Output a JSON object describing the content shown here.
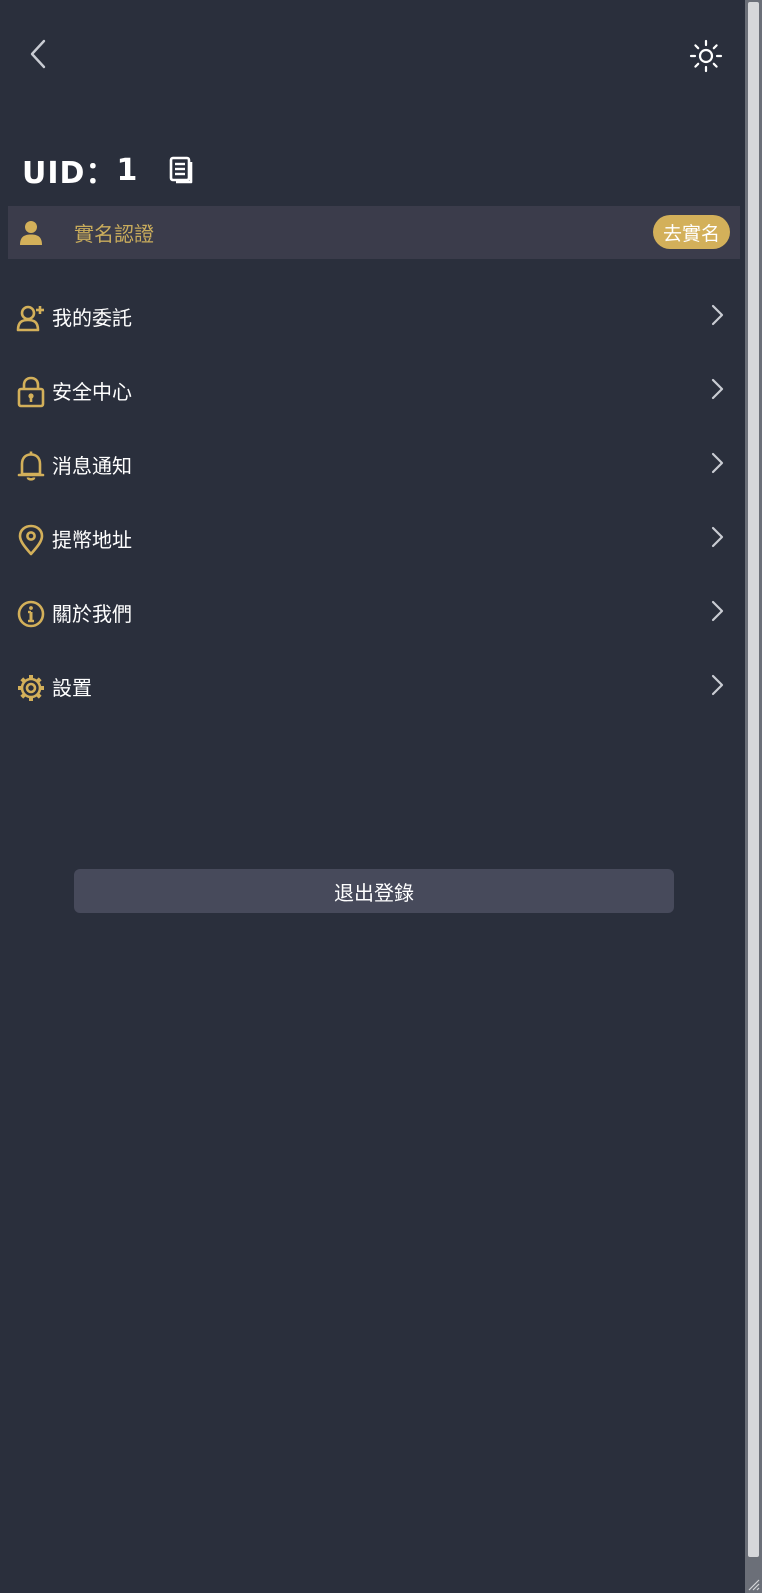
{
  "header": {
    "back_icon": "chevron-left-icon",
    "theme_icon": "sun-icon"
  },
  "account": {
    "uid_label": "UID：",
    "uid_value": "1",
    "copy_icon": "copy-icon"
  },
  "verification": {
    "icon": "person-icon",
    "label": "實名認證",
    "button_label": "去實名",
    "accent_color": "#d3b05a"
  },
  "menu": [
    {
      "label": "我的委託",
      "icon": "user-add-icon"
    },
    {
      "label": "安全中心",
      "icon": "lock-icon"
    },
    {
      "label": "消息通知",
      "icon": "bell-icon"
    },
    {
      "label": "提幣地址",
      "icon": "location-pin-icon"
    },
    {
      "label": "關於我們",
      "icon": "info-icon"
    },
    {
      "label": "設置",
      "icon": "gear-icon"
    }
  ],
  "logout": {
    "label": "退出登錄"
  },
  "colors": {
    "background": "#2a2f3c",
    "accent": "#d3b05a",
    "panel": "#3b3c4b",
    "button": "#474a5b"
  }
}
